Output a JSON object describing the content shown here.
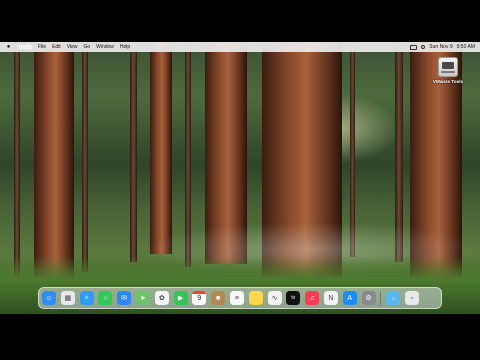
{
  "menubar": {
    "apple_icon": "apple-logo-icon",
    "app_name": "Finder",
    "items": [
      "File",
      "Edit",
      "View",
      "Go",
      "Window",
      "Help"
    ],
    "date": "Sun Nov 9",
    "time": "9:50 AM"
  },
  "desktop_icon": {
    "label": "VMware Tools",
    "icon": "vmware-tools-disk-icon"
  },
  "dock": {
    "apps": [
      {
        "name": "finder",
        "icon": "finder-icon",
        "color": "#2f8ef0",
        "running": true
      },
      {
        "name": "launchpad",
        "icon": "launchpad-icon",
        "color": "#e8e8ee"
      },
      {
        "name": "safari",
        "icon": "safari-icon",
        "color": "#2e9cf5"
      },
      {
        "name": "messages",
        "icon": "messages-icon",
        "color": "#34c759"
      },
      {
        "name": "mail",
        "icon": "mail-icon",
        "color": "#2f86f6"
      },
      {
        "name": "maps",
        "icon": "maps-icon",
        "color": "#6cc46a"
      },
      {
        "name": "photos",
        "icon": "photos-icon",
        "color": "#f5f5f5"
      },
      {
        "name": "facetime",
        "icon": "facetime-icon",
        "color": "#32c35a"
      },
      {
        "name": "calendar",
        "icon": "calendar-icon",
        "color": "#ffffff",
        "day": "9"
      },
      {
        "name": "contacts",
        "icon": "contacts-icon",
        "color": "#b08a55"
      },
      {
        "name": "reminders",
        "icon": "reminders-icon",
        "color": "#f7f7f7"
      },
      {
        "name": "notes",
        "icon": "notes-icon",
        "color": "#fbd84a"
      },
      {
        "name": "freeform",
        "icon": "freeform-icon",
        "color": "#f2f2f2"
      },
      {
        "name": "tv",
        "icon": "apple-tv-icon",
        "color": "#111111",
        "label": "tv"
      },
      {
        "name": "music",
        "icon": "music-icon",
        "color": "#fa3c55"
      },
      {
        "name": "news",
        "icon": "news-icon",
        "color": "#f3f3f3"
      },
      {
        "name": "app-store",
        "icon": "app-store-icon",
        "color": "#1c8cf4"
      },
      {
        "name": "system-settings",
        "icon": "gear-icon",
        "color": "#8a8a8e",
        "running": true
      }
    ],
    "right": [
      {
        "name": "downloads-folder",
        "icon": "downloads-folder-icon",
        "color": "#5ab6ef"
      },
      {
        "name": "trash",
        "icon": "trash-icon",
        "color": "#e6e8ea"
      }
    ]
  }
}
